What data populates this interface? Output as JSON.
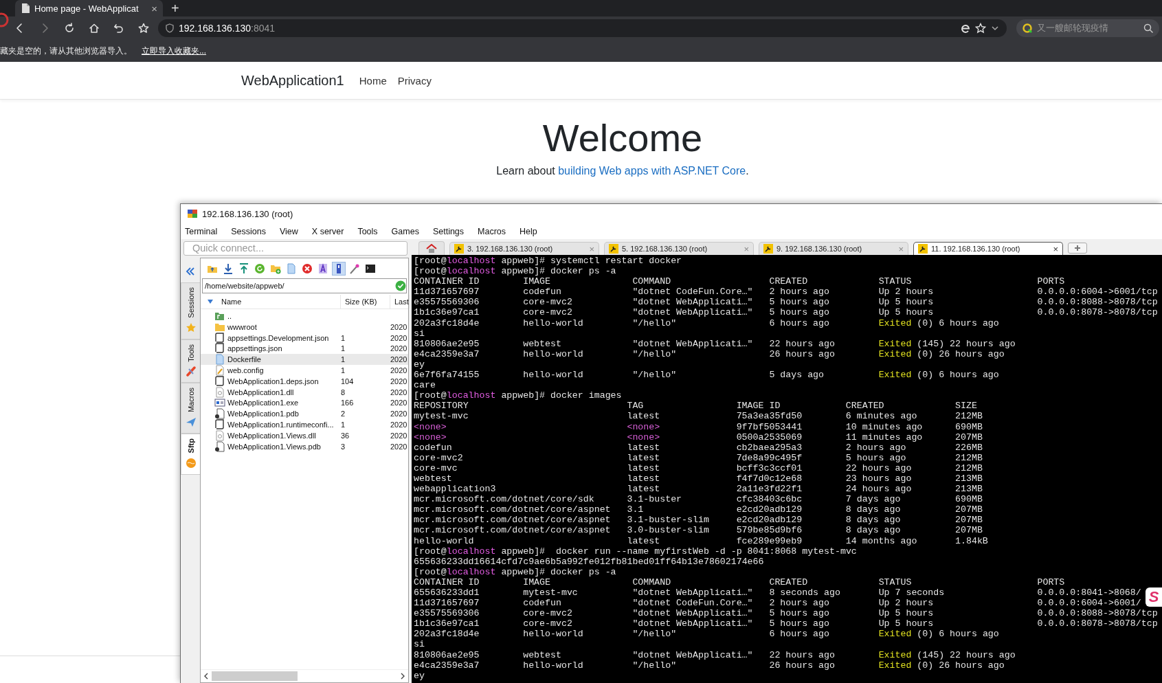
{
  "browser": {
    "tab": {
      "title": "Home page - WebApplicat",
      "close": "×"
    },
    "new_tab": "+",
    "address": {
      "host": "192.168.136.130",
      "port": ":8041"
    },
    "search": {
      "placeholder": "又一艘邮轮现疫情"
    },
    "bookmarks_bar": {
      "message": "藏夹是空的，请从其他浏览器导入。",
      "link": "立即导入收藏夹..."
    }
  },
  "page": {
    "brand": "WebApplication1",
    "nav": [
      "Home",
      "Privacy"
    ],
    "heading": "Welcome",
    "lead": {
      "before": "Learn about ",
      "link": "building Web apps with ASP.NET Core",
      "after": "."
    }
  },
  "mobaxterm": {
    "title": "192.168.136.130 (root)",
    "menu": [
      "Terminal",
      "Sessions",
      "View",
      "X server",
      "Tools",
      "Games",
      "Settings",
      "Macros",
      "Help"
    ],
    "quick_connect": {
      "placeholder": "Quick connect..."
    },
    "side_tabs": [
      {
        "label": "Sessions",
        "kind": "star",
        "selected": false
      },
      {
        "label": "Tools",
        "kind": "tools",
        "selected": false
      },
      {
        "label": "Macros",
        "kind": "plane",
        "selected": false
      },
      {
        "label": "Sftp",
        "kind": "sftp",
        "selected": true
      }
    ],
    "sftp": {
      "toolbar": [
        {
          "kind": "folder-up",
          "pressed": false
        },
        {
          "kind": "download",
          "pressed": false
        },
        {
          "kind": "upload",
          "pressed": false
        },
        {
          "kind": "refresh",
          "pressed": false
        },
        {
          "kind": "new-folder",
          "pressed": false
        },
        {
          "kind": "new-file",
          "pressed": false
        },
        {
          "kind": "delete",
          "pressed": false
        },
        {
          "kind": "text",
          "pressed": false
        },
        {
          "kind": "panel",
          "pressed": true
        },
        {
          "kind": "wand",
          "pressed": false
        },
        {
          "kind": "terminal",
          "pressed": false
        }
      ],
      "path": "/home/website/appweb/",
      "columns": [
        "Name",
        "Size (KB)",
        "Last"
      ],
      "files": [
        {
          "name": "..",
          "kind": "parent",
          "selected": false
        },
        {
          "name": "wwwroot",
          "kind": "folder",
          "date": "2020",
          "selected": false
        },
        {
          "name": "appsettings.Development.json",
          "kind": "script",
          "size": "1",
          "date": "2020",
          "selected": false
        },
        {
          "name": "appsettings.json",
          "kind": "script",
          "size": "1",
          "date": "2020",
          "selected": false
        },
        {
          "name": "Dockerfile",
          "kind": "document",
          "size": "1",
          "date": "2020",
          "selected": true
        },
        {
          "name": "web.config",
          "kind": "config",
          "size": "1",
          "date": "2020",
          "selected": false
        },
        {
          "name": "WebApplication1.deps.json",
          "kind": "script",
          "size": "104",
          "date": "2020",
          "selected": false
        },
        {
          "name": "WebApplication1.dll",
          "kind": "library",
          "size": "8",
          "date": "2020",
          "selected": false
        },
        {
          "name": "WebApplication1.exe",
          "kind": "exe",
          "size": "166",
          "date": "2020",
          "selected": false
        },
        {
          "name": "WebApplication1.pdb",
          "kind": "pdb",
          "size": "2",
          "date": "2020",
          "selected": false
        },
        {
          "name": "WebApplication1.runtimeconfi...",
          "kind": "script",
          "size": "1",
          "date": "2020",
          "selected": false
        },
        {
          "name": "WebApplication1.Views.dll",
          "kind": "library",
          "size": "36",
          "date": "2020",
          "selected": false
        },
        {
          "name": "WebApplication1.Views.pdb",
          "kind": "pdb",
          "size": "3",
          "date": "2020",
          "selected": false
        }
      ]
    },
    "terminal": {
      "tabs": [
        {
          "label": "3. 192.168.136.130 (root)",
          "close": "×",
          "selected": false
        },
        {
          "label": "5. 192.168.136.130 (root)",
          "close": "×",
          "selected": false
        },
        {
          "label": "9. 192.168.136.130 (root)",
          "close": "×",
          "selected": false
        },
        {
          "label": "11. 192.168.136.130 (root)",
          "close": "×",
          "selected": true
        }
      ],
      "lines": [
        {
          "kind": "text",
          "spans": [
            {
              "text": "[root@"
            },
            {
              "text": "localhost",
              "color": "#e35de3"
            },
            {
              "text": " appweb]# systemctl restart docker"
            }
          ]
        },
        {
          "kind": "text",
          "spans": [
            {
              "text": "[root@"
            },
            {
              "text": "localhost",
              "color": "#e35de3"
            },
            {
              "text": " appweb]# docker ps -a"
            }
          ]
        },
        {
          "kind": "ps",
          "cells": [
            "CONTAINER ID",
            "IMAGE",
            "COMMAND",
            "CREATED",
            "STATUS",
            "PORTS"
          ]
        },
        {
          "kind": "ps",
          "cells": [
            "11d371657697",
            "codefun",
            "\"dotnet CodeFun.Core…\"",
            "2 hours ago",
            "Up 2 hours",
            "0.0.0.0:6004->6001/tcp"
          ]
        },
        {
          "kind": "ps",
          "cells": [
            "e35575569306",
            "core-mvc2",
            "\"dotnet WebApplicati…\"",
            "5 hours ago",
            "Up 5 hours",
            "0.0.0.0:8088->8078/tcp"
          ]
        },
        {
          "kind": "ps",
          "cells": [
            "1b1c36e97ca1",
            "core-mvc2",
            "\"dotnet WebApplicati…\"",
            "5 hours ago",
            "Up 5 hours",
            "0.0.0.0:8078->8078/tcp"
          ]
        },
        {
          "kind": "ps",
          "cells": [
            "202a3fc18d4e",
            "hello-world",
            "\"/hello\"",
            "6 hours ago",
            [
              {
                "text": "Exited",
                "color": "#e0e020"
              },
              {
                "text": " (0) 6 hours ago"
              }
            ]
          ]
        },
        {
          "kind": "text",
          "spans": [
            {
              "text": "si"
            }
          ]
        },
        {
          "kind": "ps",
          "cells": [
            "810806ae2e95",
            "webtest",
            "\"dotnet WebApplicati…\"",
            "22 hours ago",
            [
              {
                "text": "Exited",
                "color": "#e0e020"
              },
              {
                "text": " (145) 22 hours ago"
              }
            ]
          ]
        },
        {
          "kind": "ps",
          "cells": [
            "e4ca2359e3a7",
            "hello-world",
            "\"/hello\"",
            "26 hours ago",
            [
              {
                "text": "Exited",
                "color": "#e0e020"
              },
              {
                "text": " (0) 26 hours ago"
              }
            ]
          ]
        },
        {
          "kind": "text",
          "spans": [
            {
              "text": "ey"
            }
          ]
        },
        {
          "kind": "ps",
          "cells": [
            "6e7f6fa74155",
            "hello-world",
            "\"/hello\"",
            "5 days ago",
            [
              {
                "text": "Exited",
                "color": "#e0e020"
              },
              {
                "text": " (0) 6 hours ago"
              }
            ]
          ]
        },
        {
          "kind": "text",
          "spans": [
            {
              "text": "care"
            }
          ]
        },
        {
          "kind": "text",
          "spans": [
            {
              "text": "[root@"
            },
            {
              "text": "localhost",
              "color": "#e35de3"
            },
            {
              "text": " appweb]# docker images"
            }
          ]
        },
        {
          "kind": "images",
          "cells": [
            "REPOSITORY",
            "TAG",
            "IMAGE ID",
            "CREATED",
            "SIZE"
          ]
        },
        {
          "kind": "images",
          "cells": [
            "mytest-mvc",
            "latest",
            "75a3ea35fd50",
            "6 minutes ago",
            "212MB"
          ]
        },
        {
          "kind": "images",
          "cells": [
            [
              {
                "text": "<none>",
                "color": "#d75fd7"
              }
            ],
            [
              {
                "text": "<none>",
                "color": "#d75fd7"
              }
            ],
            "9f7bf5053441",
            "10 minutes ago",
            "690MB"
          ]
        },
        {
          "kind": "images",
          "cells": [
            [
              {
                "text": "<none>",
                "color": "#d75fd7"
              }
            ],
            [
              {
                "text": "<none>",
                "color": "#d75fd7"
              }
            ],
            "0500a2535069",
            "11 minutes ago",
            "207MB"
          ]
        },
        {
          "kind": "images",
          "cells": [
            "codefun",
            "latest",
            "cb2baea295a3",
            "2 hours ago",
            "226MB"
          ]
        },
        {
          "kind": "images",
          "cells": [
            "core-mvc2",
            "latest",
            "7de8a99c495f",
            "5 hours ago",
            "212MB"
          ]
        },
        {
          "kind": "images",
          "cells": [
            "core-mvc",
            "latest",
            "bcff3c3ccf01",
            "22 hours ago",
            "212MB"
          ]
        },
        {
          "kind": "images",
          "cells": [
            "webtest",
            "latest",
            "f4f7d0c12e68",
            "23 hours ago",
            "213MB"
          ]
        },
        {
          "kind": "images",
          "cells": [
            "webapplication3",
            "latest",
            "2a11e3fd22f1",
            "24 hours ago",
            "213MB"
          ]
        },
        {
          "kind": "images",
          "cells": [
            "mcr.microsoft.com/dotnet/core/sdk",
            "3.1-buster",
            "cfc38403c6bc",
            "7 days ago",
            "690MB"
          ]
        },
        {
          "kind": "images",
          "cells": [
            "mcr.microsoft.com/dotnet/core/aspnet",
            "3.1",
            "e2cd20adb129",
            "8 days ago",
            "207MB"
          ]
        },
        {
          "kind": "images",
          "cells": [
            "mcr.microsoft.com/dotnet/core/aspnet",
            "3.1-buster-slim",
            "e2cd20adb129",
            "8 days ago",
            "207MB"
          ]
        },
        {
          "kind": "images",
          "cells": [
            "mcr.microsoft.com/dotnet/core/aspnet",
            "3.0-buster-slim",
            "579be85d9bf6",
            "8 days ago",
            "207MB"
          ]
        },
        {
          "kind": "images",
          "cells": [
            "hello-world",
            "latest",
            "fce289e99eb9",
            "14 months ago",
            "1.84kB"
          ]
        },
        {
          "kind": "text",
          "spans": [
            {
              "text": "[root@"
            },
            {
              "text": "localhost",
              "color": "#e35de3"
            },
            {
              "text": " appweb]#  docker run --name myfirstWeb -d -p 8041:8068 mytest-mvc"
            }
          ]
        },
        {
          "kind": "text",
          "spans": [
            {
              "text": "655636233dd16614cfd7c9ae6b5a992fe012fb81bed01ff64b13e78602174e66"
            }
          ]
        },
        {
          "kind": "text",
          "spans": [
            {
              "text": "[root@"
            },
            {
              "text": "localhost",
              "color": "#e35de3"
            },
            {
              "text": " appweb]# docker ps -a"
            }
          ]
        },
        {
          "kind": "ps",
          "cells": [
            "CONTAINER ID",
            "IMAGE",
            "COMMAND",
            "CREATED",
            "STATUS",
            "PORTS"
          ]
        },
        {
          "kind": "ps",
          "cells": [
            "655636233dd1",
            "mytest-mvc",
            "\"dotnet WebApplicati…\"",
            "8 seconds ago",
            "Up 7 seconds",
            "0.0.0.0:8041->8068/"
          ]
        },
        {
          "kind": "ps",
          "cells": [
            "11d371657697",
            "codefun",
            "\"dotnet CodeFun.Core…\"",
            "2 hours ago",
            "Up 2 hours",
            "0.0.0.0:6004->6001/"
          ]
        },
        {
          "kind": "ps",
          "cells": [
            "e35575569306",
            "core-mvc2",
            "\"dotnet WebApplicati…\"",
            "5 hours ago",
            "Up 5 hours",
            "0.0.0.0:8088->8078/tcp"
          ]
        },
        {
          "kind": "ps",
          "cells": [
            "1b1c36e97ca1",
            "core-mvc2",
            "\"dotnet WebApplicati…\"",
            "5 hours ago",
            "Up 5 hours",
            "0.0.0.0:8078->8078/tcp"
          ]
        },
        {
          "kind": "ps",
          "cells": [
            "202a3fc18d4e",
            "hello-world",
            "\"/hello\"",
            "6 hours ago",
            [
              {
                "text": "Exited",
                "color": "#e0e020"
              },
              {
                "text": " (0) 6 hours ago"
              }
            ]
          ]
        },
        {
          "kind": "text",
          "spans": [
            {
              "text": "si"
            }
          ]
        },
        {
          "kind": "ps",
          "cells": [
            "810806ae2e95",
            "webtest",
            "\"dotnet WebApplicati…\"",
            "22 hours ago",
            [
              {
                "text": "Exited",
                "color": "#e0e020"
              },
              {
                "text": " (145) 22 hours ago"
              }
            ]
          ]
        },
        {
          "kind": "ps",
          "cells": [
            "e4ca2359e3a7",
            "hello-world",
            "\"/hello\"",
            "26 hours ago",
            [
              {
                "text": "Exited",
                "color": "#e0e020"
              },
              {
                "text": " (0) 26 hours ago"
              }
            ]
          ]
        },
        {
          "kind": "text",
          "spans": [
            {
              "text": "ey"
            }
          ]
        }
      ]
    },
    "ime_badge": {
      "label": "S"
    }
  }
}
